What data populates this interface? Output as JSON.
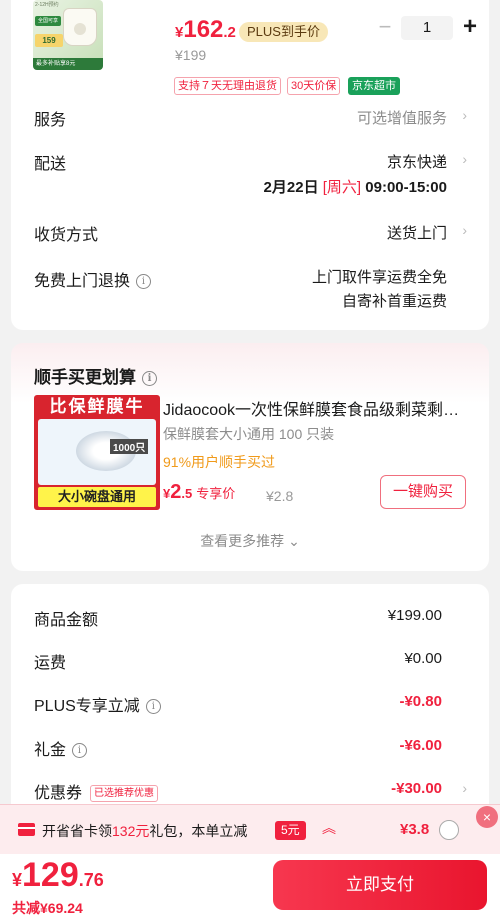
{
  "product": {
    "price_yen": "¥",
    "price_int": "162",
    "price_dec": ".2",
    "plus_tag": "PLUS到手价",
    "original_price": "¥199",
    "quantity": "1",
    "minus": "−",
    "plus": "+",
    "service_tags": [
      "支持７天无理由退货",
      "30天价保"
    ],
    "store_tag": "京东超市",
    "thumb_labels": [
      "2-12H预约",
      "全国可享",
      "159",
      "最多补贴享8元"
    ]
  },
  "order_info": {
    "service": {
      "label": "服务",
      "value": "可选增值服务"
    },
    "delivery": {
      "label": "配送",
      "value": "京东快递",
      "date": "2月22日",
      "weekday": "[周六]",
      "time": "09:00-15:00"
    },
    "receive": {
      "label": "收货方式",
      "value": "送货上门"
    },
    "return": {
      "label": "免费上门退换",
      "line1": "上门取件享运费全免",
      "line2": "自寄补首重运费"
    },
    "chevron": "›",
    "info": "i"
  },
  "recommendation": {
    "title": "顺手买更划算",
    "img_header": "比保鲜膜牛",
    "img_count": "1000只",
    "img_footer": "大小碗盘通用",
    "name": "Jidaocook一次性保鲜膜套食品级剩菜剩饭专用",
    "spec": "保鲜膜套大小通用 100 只装",
    "buy_rate": "91%用户顺手买过",
    "price_yen": "¥",
    "price_int": "2",
    "price_dec": ".5",
    "price_label": "专享价",
    "old_price": "¥2.8",
    "buy_button": "一键购买",
    "more": "查看更多推荐 ⌄"
  },
  "summary": {
    "rows": [
      {
        "label": "商品金额",
        "value": "¥199.00"
      },
      {
        "label": "运费",
        "value": "¥0.00"
      },
      {
        "label": "PLUS专享立减",
        "value": "-¥0.80"
      },
      {
        "label": "礼金",
        "value": "-¥6.00"
      },
      {
        "label": "优惠券",
        "value": "-¥30.00",
        "tag": "已选推荐优惠"
      }
    ]
  },
  "plus_bar": {
    "text_a": "开省省卡领",
    "text_red": "132元",
    "text_b": "礼包，本单立减",
    "chip": "5元",
    "arrow": "︽",
    "price": "¥3.8",
    "close": "×"
  },
  "checkout": {
    "total_yen": "¥",
    "total_int": "129",
    "total_dec": ".76",
    "saved": "共减¥69.24",
    "pay_button": "立即支付"
  }
}
